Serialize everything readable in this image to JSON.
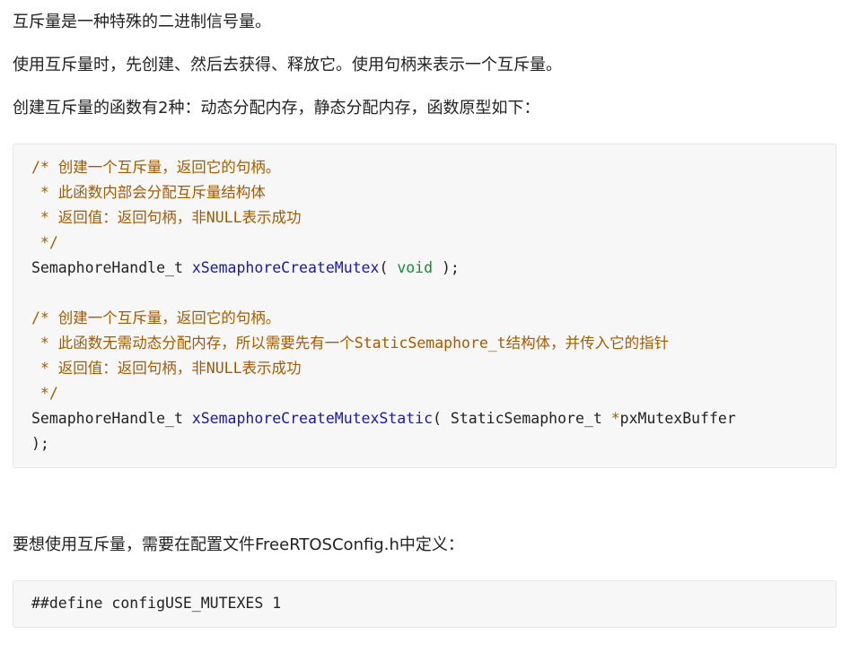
{
  "paragraphs": {
    "p1": "互斥量是一种特殊的二进制信号量。",
    "p2": "使用互斥量时，先创建、然后去获得、释放它。使用句柄来表示一个互斥量。",
    "p3": "创建互斥量的函数有2种：动态分配内存，静态分配内存，函数原型如下：",
    "p4": "要想使用互斥量，需要在配置文件FreeRTOSConfig.h中定义："
  },
  "code1": {
    "block1": {
      "c1": "/* 创建一个互斥量，返回它的句柄。",
      "c2": " * 此函数内部会分配互斥量结构体",
      "c3": " * 返回值：返回句柄，非NULL表示成功",
      "c4": " */",
      "type": "SemaphoreHandle_t ",
      "fn": "xSemaphoreCreateMutex",
      "open": "( ",
      "kw": "void",
      "close": " );"
    },
    "block2": {
      "c1": "/* 创建一个互斥量，返回它的句柄。",
      "c2": " * 此函数无需动态分配内存，所以需要先有一个StaticSemaphore_t结构体，并传入它的指针",
      "c3": " * 返回值：返回句柄，非NULL表示成功",
      "c4": " */",
      "type": "SemaphoreHandle_t ",
      "fn": "xSemaphoreCreateMutexStatic",
      "open": "( StaticSemaphore_t ",
      "star": "*",
      "param": "pxMutexBuffer",
      "close": ");"
    }
  },
  "code2": {
    "line": "##define configUSE_MUTEXES 1"
  },
  "colors": {
    "comment": "#a15c00",
    "function": "#1a1aa6",
    "keyword": "#178a3a",
    "code_background": "#f7f7f7"
  }
}
